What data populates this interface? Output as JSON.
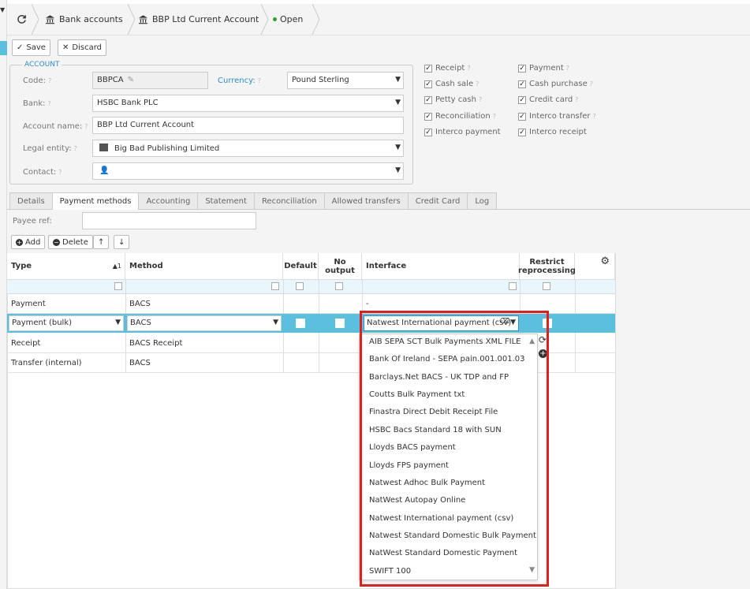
{
  "breadcrumb": {
    "refresh_icon": "refresh-icon",
    "bank_accounts": "Bank accounts",
    "account": "BBP Ltd Current Account",
    "status": "Open"
  },
  "toolbar": {
    "save": "Save",
    "discard": "Discard"
  },
  "account": {
    "legend": "ACCOUNT",
    "code_label": "Code:",
    "code_value": "BBPCA",
    "currency_label": "Currency:",
    "currency_value": "Pound Sterling",
    "bank_label": "Bank:",
    "bank_value": "HSBC Bank PLC",
    "name_label": "Account name:",
    "name_value": "BBP Ltd Current Account",
    "legal_label": "Legal entity:",
    "legal_value": "Big Bad Publishing Limited",
    "contact_label": "Contact:",
    "q": "?"
  },
  "checks": [
    {
      "label": "Receipt",
      "q": "?"
    },
    {
      "label": "Payment",
      "q": "?"
    },
    {
      "label": "Cash sale",
      "q": "?"
    },
    {
      "label": "Cash purchase",
      "q": "?"
    },
    {
      "label": "Petty cash",
      "q": "?"
    },
    {
      "label": "Credit card",
      "q": "?"
    },
    {
      "label": "Reconciliation",
      "q": "?"
    },
    {
      "label": "Interco transfer",
      "q": "?"
    },
    {
      "label": "Interco payment",
      "q": ""
    },
    {
      "label": "Interco receipt",
      "q": ""
    }
  ],
  "tabs": [
    "Details",
    "Payment methods",
    "Accounting",
    "Statement",
    "Reconciliation",
    "Allowed transfers",
    "Credit Card",
    "Log"
  ],
  "payee_ref_label": "Payee ref:",
  "grid_toolbar": {
    "add": "Add",
    "delete": "Delete",
    "up": "↑",
    "down": "↓"
  },
  "grid": {
    "headers": {
      "type": "Type",
      "sort": "▲1",
      "method": "Method",
      "default": "Default",
      "no_output_1": "No",
      "no_output_2": "output",
      "interface": "Interface",
      "restrict_1": "Restrict",
      "restrict_2": "reprocessing"
    },
    "rows": [
      {
        "type": "Payment",
        "method": "BACS",
        "interface": "-"
      },
      {
        "type": "Payment (bulk)",
        "method": "BACS",
        "interface": "Natwest International payment (csv)"
      },
      {
        "type": "Receipt",
        "method": "BACS Receipt",
        "interface": ""
      },
      {
        "type": "Transfer (internal)",
        "method": "BACS",
        "interface": ""
      }
    ]
  },
  "dropdown_options": [
    "AIB SEPA SCT Bulk Payments XML FILE",
    "Bank Of Ireland - SEPA pain.001.001.03",
    "Barclays.Net BACS - UK TDP and FP",
    "Coutts Bulk Payment txt",
    "Finastra Direct Debit Receipt File",
    "HSBC Bacs Standard 18 with SUN",
    "Lloyds BACS payment",
    "Lloyds FPS payment",
    "Natwest Adhoc Bulk Payment",
    "NatWest Autopay Online",
    "Natwest International payment (csv)",
    "Natwest Standard Domestic Bulk Payment",
    "NatWest Standard Domestic Payment",
    "SWIFT 100"
  ],
  "colors": {
    "accent": "#2d8fc6",
    "selected_row": "#5bc0de",
    "highlight": "#e02020",
    "status_dot": "#2ca02c"
  }
}
